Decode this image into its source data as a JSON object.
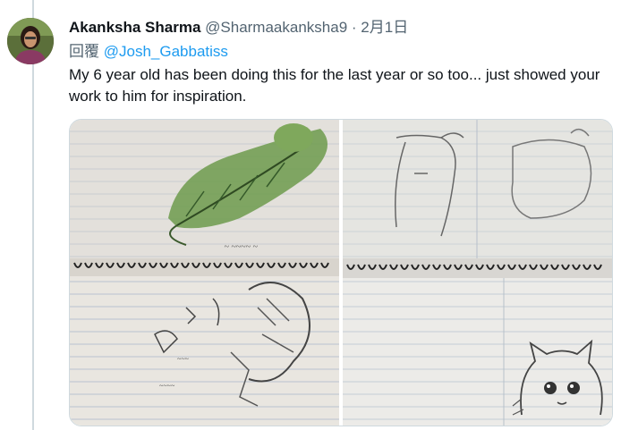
{
  "tweet": {
    "author_name": "Akanksha Sharma",
    "author_handle": "@Sharmaakanksha9",
    "separator": "·",
    "date": "2月1日",
    "reply_label": "回覆",
    "reply_to": "@Josh_Gabbatiss",
    "text": "My 6 year old has been doing this for the last year or so too... just showed your work to him for inspiration."
  },
  "media": {
    "photo_count": 2,
    "photos": [
      {
        "alt": "child's pencil drawings of a lizard and birds in a spiral notebook"
      },
      {
        "alt": "child's pencil drawings of dogs and a cat in a spiral notebook"
      }
    ]
  },
  "colors": {
    "link": "#1d9bf0",
    "secondary_text": "#536471",
    "thread_line": "#cfd9de"
  },
  "icons": [
    "user-avatar",
    "more-options-icon"
  ]
}
